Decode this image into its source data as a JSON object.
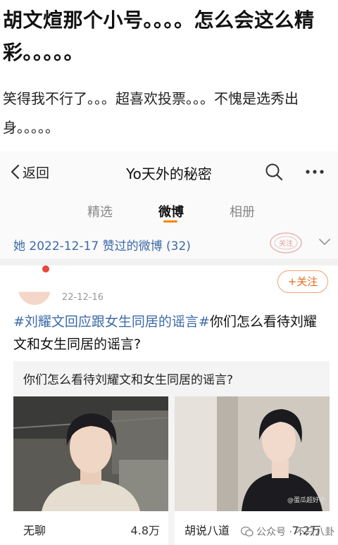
{
  "article": {
    "title": "胡文煊那个小号。。。。怎么会这么精彩。。。。。",
    "body": "笑得我不行了。。。超喜欢投票。。。不愧是选秀出身。。。。。"
  },
  "nav": {
    "back_label": "返回",
    "title": "Yo天外的秘密",
    "search_icon": "search-icon",
    "more_icon": "more-icon"
  },
  "tabs": [
    {
      "label": "精选",
      "active": false
    },
    {
      "label": "微博",
      "active": true
    },
    {
      "label": "相册",
      "active": false
    }
  ],
  "liked": {
    "text": "她 2022-12-17 赞过的微博 (32)",
    "stamp_text": "关注"
  },
  "post": {
    "date": "22-12-16",
    "follow_label": "+关注",
    "topic": "#刘耀文回应跟女生同居的谣言#",
    "text": "你们怎么看待刘耀文和女生同居的谣言?",
    "poll": {
      "question": "你们怎么看待刘耀文和女生同居的谣言?",
      "options": [
        {
          "label": "无聊",
          "count": "4.8万"
        },
        {
          "label": "胡说八道",
          "count": "7.2万"
        }
      ],
      "photo_watermark": "@蛋瓜超好吃"
    }
  },
  "watermark": {
    "text": "公众号 · 不只八卦"
  },
  "colors": {
    "accent": "#ff8200",
    "link": "#3b6aa8",
    "follow": "#e86a1a"
  }
}
